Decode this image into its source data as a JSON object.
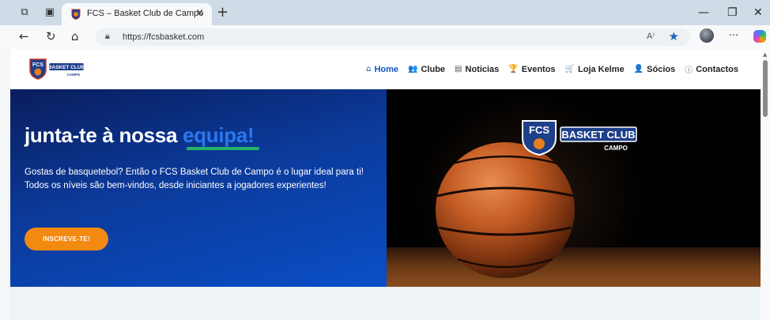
{
  "browser": {
    "tab_title": "FCS – Basket Club de Campo",
    "tab_close": "×",
    "new_tab": "+",
    "url": "https://fcsbasket.com",
    "read_aloud": "A⁾",
    "more_label": "···",
    "controls": {
      "minimize": "—",
      "restore": "❐",
      "close": "✕"
    },
    "nav_icons": {
      "back": "←",
      "refresh": "↻",
      "home": "⌂",
      "lock": "🔒",
      "star": "★"
    }
  },
  "site": {
    "logo_text": {
      "fcs": "FCS",
      "basket": "BASKET CLUB",
      "campo": "CAMPO"
    },
    "nav": [
      {
        "label": "Home",
        "icon": "home-icon",
        "glyph": "⌂",
        "active": true
      },
      {
        "label": "Clube",
        "icon": "people-icon",
        "glyph": "👥",
        "active": false
      },
      {
        "label": "Noticias",
        "icon": "newspaper-icon",
        "glyph": "▤",
        "active": false
      },
      {
        "label": "Eventos",
        "icon": "trophy-icon",
        "glyph": "🏆",
        "active": false
      },
      {
        "label": "Loja Kelme",
        "icon": "cart-icon",
        "glyph": "🛒",
        "active": false
      },
      {
        "label": "Sócios",
        "icon": "user-icon",
        "glyph": "👤",
        "active": false
      },
      {
        "label": "Contactos",
        "icon": "info-icon",
        "glyph": "ⓘ",
        "active": false
      }
    ],
    "hero": {
      "title_main": "junta-te à nossa ",
      "title_highlight": "equipa!",
      "paragraph_1": "Gostas de basquetebol? Então o FCS Basket Club de Campo é o lugar ideal para ti!",
      "paragraph_2": "Todos os níveis são bem-vindos, desde iniciantes a jogadores experientes!",
      "cta_label": "INSCREVE-TE!"
    }
  },
  "colors": {
    "accent_blue": "#1557c0",
    "cta_orange": "#f28a12",
    "highlight_green": "#23b36a"
  }
}
